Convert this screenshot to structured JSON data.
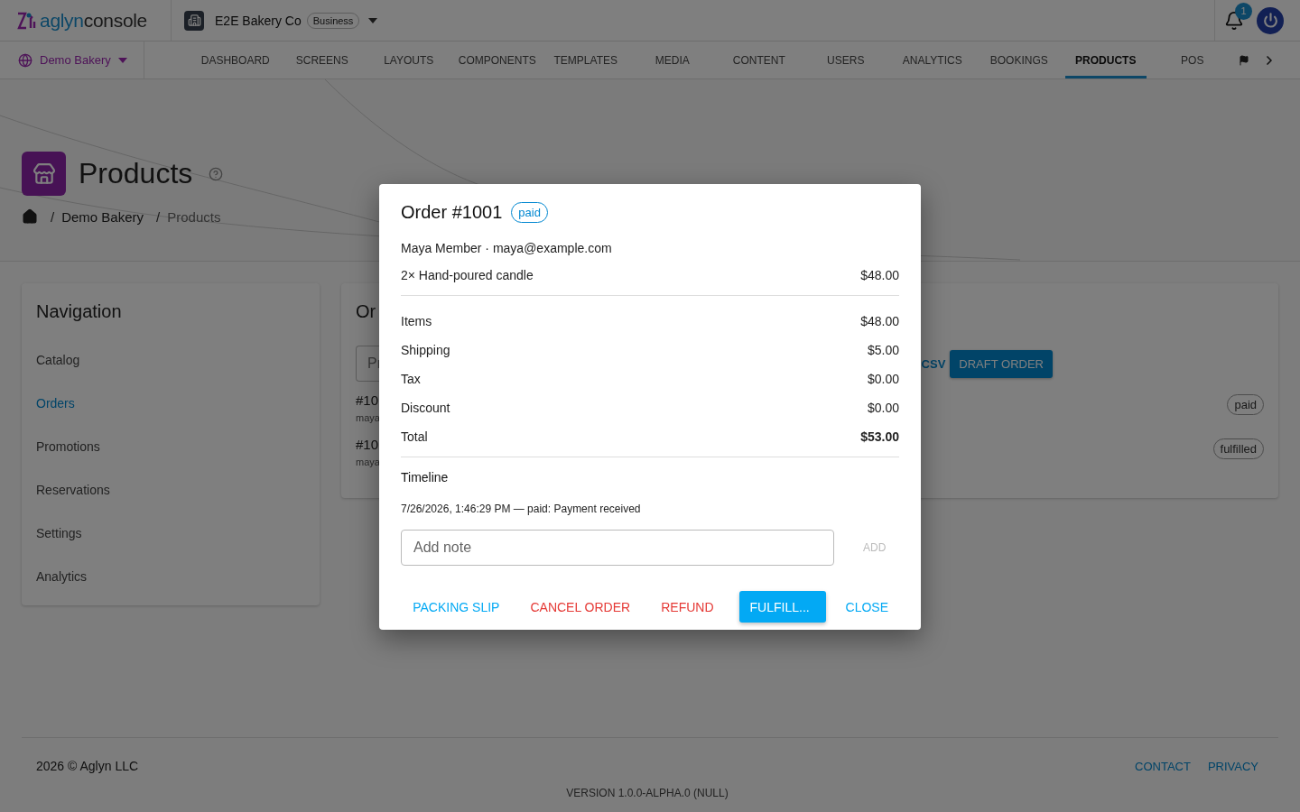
{
  "header": {
    "logo": {
      "brand": "aglyn",
      "product": "console"
    },
    "organization": {
      "name": "E2E Bakery Co",
      "plan": "Business"
    },
    "notifications": {
      "count": "1"
    }
  },
  "site_selector": {
    "label": "Demo Bakery"
  },
  "tabs": [
    {
      "label": "DASHBOARD",
      "selected": false
    },
    {
      "label": "SCREENS",
      "selected": false
    },
    {
      "label": "LAYOUTS",
      "selected": false
    },
    {
      "label": "COMPONENTS",
      "selected": false
    },
    {
      "label": "TEMPLATES",
      "selected": false
    },
    {
      "label": "MEDIA",
      "selected": false
    },
    {
      "label": "CONTENT",
      "selected": false
    },
    {
      "label": "USERS",
      "selected": false
    },
    {
      "label": "ANALYTICS",
      "selected": false
    },
    {
      "label": "BOOKINGS",
      "selected": false
    },
    {
      "label": "PRODUCTS",
      "selected": true
    },
    {
      "label": "POS",
      "selected": false
    }
  ],
  "page": {
    "title": "Products",
    "breadcrumb": [
      {
        "kind": "separator",
        "text": "/"
      },
      {
        "kind": "link",
        "text": "Demo Bakery"
      },
      {
        "kind": "separator",
        "text": "/"
      },
      {
        "kind": "current",
        "text": "Products"
      }
    ]
  },
  "navigation": {
    "title": "Navigation",
    "items": [
      {
        "label": "Catalog",
        "selected": false
      },
      {
        "label": "Orders",
        "selected": true
      },
      {
        "label": "Promotions",
        "selected": false
      },
      {
        "label": "Reservations",
        "selected": false
      },
      {
        "label": "Settings",
        "selected": false
      },
      {
        "label": "Analytics",
        "selected": false
      }
    ]
  },
  "orders_card": {
    "title": "Or",
    "search": {
      "placeholder": "Pr"
    },
    "actions": [
      {
        "label": "CSV",
        "kind": "text"
      },
      {
        "label": "DRAFT ORDER",
        "kind": "contained"
      }
    ],
    "rows": [
      {
        "number": "#10",
        "customer": "maya",
        "status": "paid"
      },
      {
        "number": "#10",
        "customer": "maya",
        "status": "fulfilled"
      }
    ]
  },
  "dialog": {
    "title": "Order #1001",
    "status": "paid",
    "customer": "Maya Member · maya@example.com",
    "line_items": [
      {
        "label": "2× Hand-poured candle",
        "amount": "$48.00"
      }
    ],
    "summary": [
      {
        "label": "Items",
        "amount": "$48.00",
        "kind": "normal"
      },
      {
        "label": "Shipping",
        "amount": "$5.00",
        "kind": "normal"
      },
      {
        "label": "Tax",
        "amount": "$0.00",
        "kind": "normal"
      },
      {
        "label": "Discount",
        "amount": "$0.00",
        "kind": "normal"
      },
      {
        "label": "Total",
        "amount": "$53.00",
        "kind": "total"
      }
    ],
    "timeline": {
      "title": "Timeline",
      "entries": [
        "7/26/2026, 1:46:29 PM — paid: Payment received"
      ]
    },
    "note": {
      "placeholder": "Add note",
      "add_label": "ADD",
      "add_disabled": true
    },
    "buttons": [
      {
        "label": "PACKING SLIP",
        "kind": "text"
      },
      {
        "label": "CANCEL ORDER",
        "kind": "danger"
      },
      {
        "label": "REFUND",
        "kind": "danger"
      },
      {
        "label": "FULFILL...",
        "kind": "contained"
      },
      {
        "label": "CLOSE",
        "kind": "text"
      }
    ]
  },
  "footer": {
    "copyright": "2026 © Aglyn LLC",
    "links": [
      "CONTACT",
      "PRIVACY"
    ],
    "version": "VERSION 1.0.0-ALPHA.0 (NULL)"
  }
}
